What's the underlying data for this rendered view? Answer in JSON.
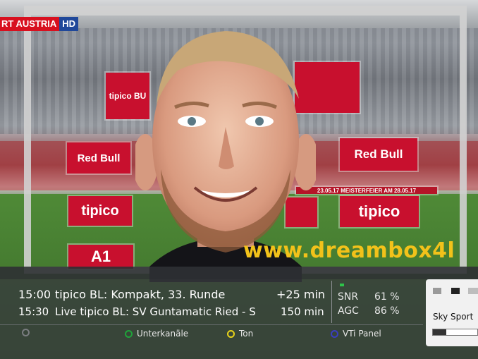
{
  "channel_logo": {
    "text_a": "RT AUSTRIA",
    "text_b": "HD"
  },
  "watermark": "www.dreambox4l",
  "ads": {
    "redbull": "Red Bull",
    "tipico": "tipico",
    "tipico_bu": "tipico BU",
    "a1": "A1",
    "ticker": "23.05.17 MEISTERFEIER AM 28.05.17"
  },
  "epg": {
    "now": {
      "time": "15:00",
      "title": "tipico BL: Kompakt, 33. Runde",
      "remaining": "+25 min"
    },
    "next": {
      "time": "15:30",
      "title": "Live tipico BL: SV Guntamatic Ried - S",
      "duration": "150 min"
    }
  },
  "signal": {
    "snr_label": "SNR",
    "snr_value": "61 %",
    "agc_label": "AGC",
    "agc_value": "86 %"
  },
  "color_buttons": [
    {
      "label": "",
      "color": "#7a7d80"
    },
    {
      "label": "Unterkanäle",
      "color": "#1fa33a"
    },
    {
      "label": "Ton",
      "color": "#e8d21a"
    },
    {
      "label": "VTi Panel",
      "color": "#3a3ec0"
    }
  ],
  "service_panel": {
    "channel_name": "Sky Sport",
    "progress": 0.3
  },
  "colors": {
    "accent_watermark": "#f2c21a",
    "infobar": "#373a3e"
  }
}
